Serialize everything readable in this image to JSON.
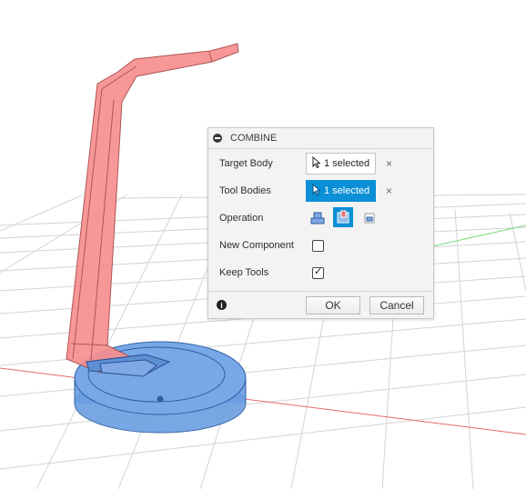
{
  "dialog": {
    "title": "COMBINE",
    "target_body": {
      "label": "Target Body",
      "value": "1 selected"
    },
    "tool_bodies": {
      "label": "Tool Bodies",
      "value": "1 selected"
    },
    "operation": {
      "label": "Operation",
      "options": [
        "join-icon",
        "cut-icon",
        "intersect-icon"
      ],
      "selected": "cut-icon"
    },
    "new_component": {
      "label": "New Component",
      "checked": false
    },
    "keep_tools": {
      "label": "Keep Tools",
      "checked": true
    },
    "clear_glyph": "×",
    "ok_label": "OK",
    "cancel_label": "Cancel",
    "info_glyph": "i"
  },
  "colors": {
    "accent": "#0b8fd6",
    "target_body": "#f78f8f",
    "tool_body": "#6a9ee0",
    "x_axis": "#e05050",
    "y_axis": "#5ad05a",
    "grid": "#d0d0d0"
  }
}
